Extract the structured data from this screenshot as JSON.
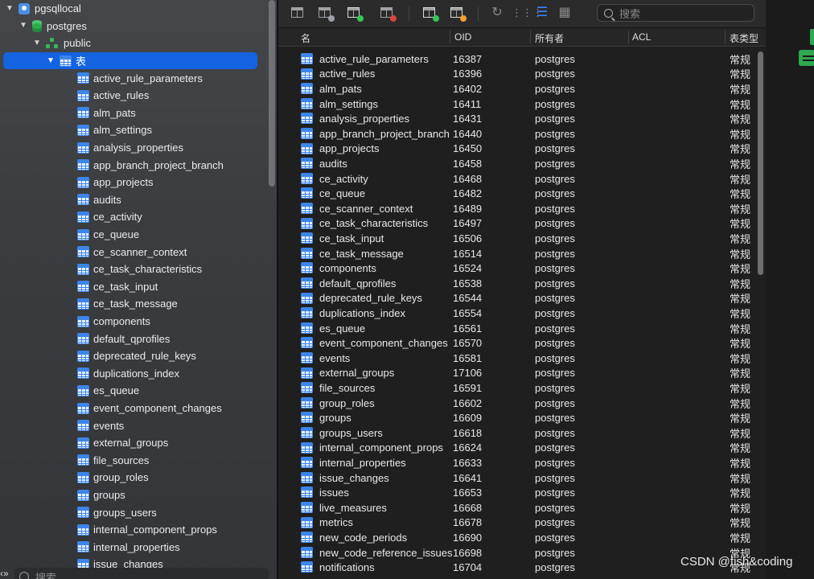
{
  "sidebar": {
    "connection": "pgsqllocal",
    "database": "postgres",
    "schema": "public",
    "tables_node": "表",
    "tables": [
      "active_rule_parameters",
      "active_rules",
      "alm_pats",
      "alm_settings",
      "analysis_properties",
      "app_branch_project_branch",
      "app_projects",
      "audits",
      "ce_activity",
      "ce_queue",
      "ce_scanner_context",
      "ce_task_characteristics",
      "ce_task_input",
      "ce_task_message",
      "components",
      "default_qprofiles",
      "deprecated_rule_keys",
      "duplications_index",
      "es_queue",
      "event_component_changes",
      "events",
      "external_groups",
      "file_sources",
      "group_roles",
      "groups",
      "groups_users",
      "internal_component_props",
      "internal_properties",
      "issue_changes"
    ],
    "search_placeholder": "搜索",
    "left_edge_char": "‹»"
  },
  "toolbar": {
    "search_placeholder": "搜索",
    "icons": [
      "new-table-icon",
      "design-table-icon",
      "add-table-icon",
      "delete-table-icon",
      "import-icon",
      "export-icon",
      "refresh-icon",
      "grid-view-icon",
      "list-view-icon",
      "detail-view-icon"
    ]
  },
  "table": {
    "columns": [
      "名",
      "OID",
      "所有者",
      "ACL",
      "表类型"
    ],
    "rows": [
      {
        "name": "active_rule_parameters",
        "oid": "16387",
        "owner": "postgres",
        "type": "常规"
      },
      {
        "name": "active_rules",
        "oid": "16396",
        "owner": "postgres",
        "type": "常规"
      },
      {
        "name": "alm_pats",
        "oid": "16402",
        "owner": "postgres",
        "type": "常规"
      },
      {
        "name": "alm_settings",
        "oid": "16411",
        "owner": "postgres",
        "type": "常规"
      },
      {
        "name": "analysis_properties",
        "oid": "16431",
        "owner": "postgres",
        "type": "常规"
      },
      {
        "name": "app_branch_project_branch",
        "oid": "16440",
        "owner": "postgres",
        "type": "常规"
      },
      {
        "name": "app_projects",
        "oid": "16450",
        "owner": "postgres",
        "type": "常规"
      },
      {
        "name": "audits",
        "oid": "16458",
        "owner": "postgres",
        "type": "常规"
      },
      {
        "name": "ce_activity",
        "oid": "16468",
        "owner": "postgres",
        "type": "常规"
      },
      {
        "name": "ce_queue",
        "oid": "16482",
        "owner": "postgres",
        "type": "常规"
      },
      {
        "name": "ce_scanner_context",
        "oid": "16489",
        "owner": "postgres",
        "type": "常规"
      },
      {
        "name": "ce_task_characteristics",
        "oid": "16497",
        "owner": "postgres",
        "type": "常规"
      },
      {
        "name": "ce_task_input",
        "oid": "16506",
        "owner": "postgres",
        "type": "常规"
      },
      {
        "name": "ce_task_message",
        "oid": "16514",
        "owner": "postgres",
        "type": "常规"
      },
      {
        "name": "components",
        "oid": "16524",
        "owner": "postgres",
        "type": "常规"
      },
      {
        "name": "default_qprofiles",
        "oid": "16538",
        "owner": "postgres",
        "type": "常规"
      },
      {
        "name": "deprecated_rule_keys",
        "oid": "16544",
        "owner": "postgres",
        "type": "常规"
      },
      {
        "name": "duplications_index",
        "oid": "16554",
        "owner": "postgres",
        "type": "常规"
      },
      {
        "name": "es_queue",
        "oid": "16561",
        "owner": "postgres",
        "type": "常规"
      },
      {
        "name": "event_component_changes",
        "oid": "16570",
        "owner": "postgres",
        "type": "常规"
      },
      {
        "name": "events",
        "oid": "16581",
        "owner": "postgres",
        "type": "常规"
      },
      {
        "name": "external_groups",
        "oid": "17106",
        "owner": "postgres",
        "type": "常规"
      },
      {
        "name": "file_sources",
        "oid": "16591",
        "owner": "postgres",
        "type": "常规"
      },
      {
        "name": "group_roles",
        "oid": "16602",
        "owner": "postgres",
        "type": "常规"
      },
      {
        "name": "groups",
        "oid": "16609",
        "owner": "postgres",
        "type": "常规"
      },
      {
        "name": "groups_users",
        "oid": "16618",
        "owner": "postgres",
        "type": "常规"
      },
      {
        "name": "internal_component_props",
        "oid": "16624",
        "owner": "postgres",
        "type": "常规"
      },
      {
        "name": "internal_properties",
        "oid": "16633",
        "owner": "postgres",
        "type": "常规"
      },
      {
        "name": "issue_changes",
        "oid": "16641",
        "owner": "postgres",
        "type": "常规"
      },
      {
        "name": "issues",
        "oid": "16653",
        "owner": "postgres",
        "type": "常规"
      },
      {
        "name": "live_measures",
        "oid": "16668",
        "owner": "postgres",
        "type": "常规"
      },
      {
        "name": "metrics",
        "oid": "16678",
        "owner": "postgres",
        "type": "常规"
      },
      {
        "name": "new_code_periods",
        "oid": "16690",
        "owner": "postgres",
        "type": "常规"
      },
      {
        "name": "new_code_reference_issues",
        "oid": "16698",
        "owner": "postgres",
        "type": "常规"
      },
      {
        "name": "notifications",
        "oid": "16704",
        "owner": "postgres",
        "type": "常规"
      }
    ]
  },
  "watermark": "CSDN @fish&coding",
  "colors": {
    "selection": "#1463e0",
    "table_icon": "#3d85e8",
    "db_icon": "#2fa84f"
  }
}
